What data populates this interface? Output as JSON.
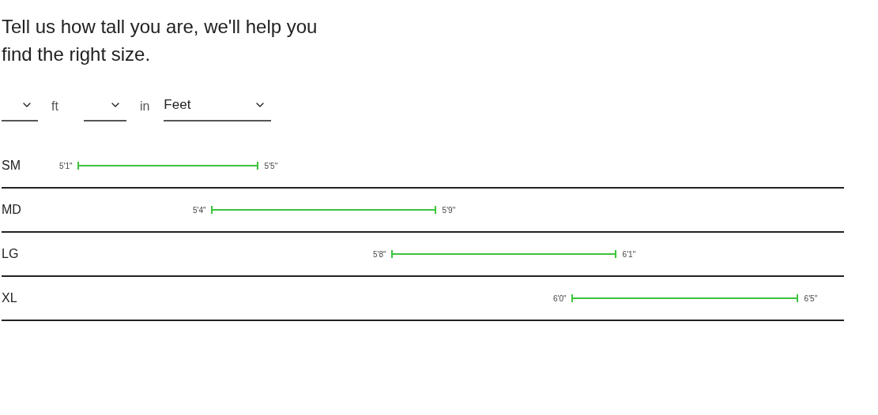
{
  "heading": "Tell us how tall you are, we'll help you find the right size.",
  "height_selects": [
    {
      "unit_label": "ft"
    },
    {
      "unit_label": "in"
    }
  ],
  "unit_select": {
    "value": "Feet"
  },
  "sizes": [
    {
      "name": "SM",
      "min": "5'1\"",
      "max": "5'5\""
    },
    {
      "name": "MD",
      "min": "5'4\"",
      "max": "5'9\""
    },
    {
      "name": "LG",
      "min": "5'8\"",
      "max": "6'1\""
    },
    {
      "name": "XL",
      "min": "6'0\"",
      "max": "6'5\""
    }
  ]
}
